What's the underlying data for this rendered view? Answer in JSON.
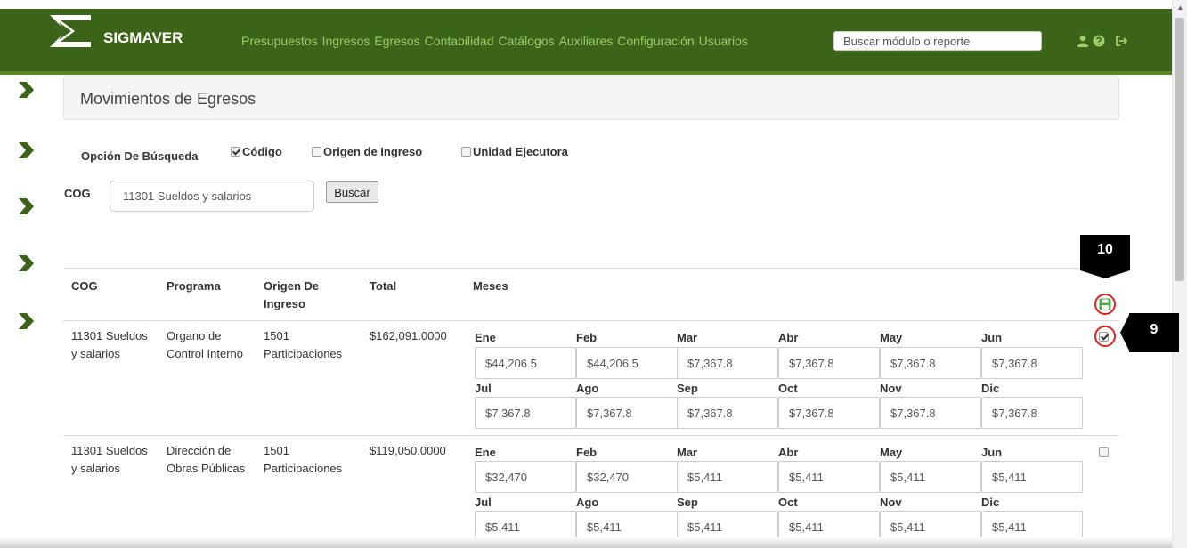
{
  "navbar": {
    "brand": "SIGMAVER",
    "links": [
      "Presupuestos",
      "Ingresos",
      "Egresos",
      "Contabilidad",
      "Catálogos",
      "Auxiliares",
      "Configuración",
      "Usuarios"
    ],
    "search_placeholder": "Buscar módulo o reporte",
    "icons": [
      "user-icon",
      "help-icon",
      "logout-icon"
    ],
    "bg_color": "#3c6419",
    "link_color": "#9ecd6a"
  },
  "sidebar": {
    "chevron_count": 5,
    "color": "#3c6419"
  },
  "page": {
    "title": "Movimientos de Egresos"
  },
  "search_options": {
    "label": "Opción De Búsqueda",
    "options": [
      {
        "label": "Código",
        "checked": true
      },
      {
        "label": "Origen de Ingreso",
        "checked": false
      },
      {
        "label": "Unidad Ejecutora",
        "checked": false
      }
    ],
    "cog_label": "COG",
    "cog_value": "11301 Sueldos y salarios",
    "search_button": "Buscar"
  },
  "table": {
    "headers": {
      "cog": "COG",
      "programa": "Programa",
      "origen": "Origen De Ingreso",
      "total": "Total",
      "meses": "Meses"
    },
    "month_labels": [
      "Ene",
      "Feb",
      "Mar",
      "Abr",
      "May",
      "Jun",
      "Jul",
      "Ago",
      "Sep",
      "Oct",
      "Nov",
      "Dic"
    ],
    "rows": [
      {
        "cog": "11301 Sueldos y salarios",
        "programa": "Organo de Control Interno",
        "origen": "1501 Participaciones",
        "total": "$162,091.0000",
        "months": [
          "$44,206.5",
          "$44,206.5",
          "$7,367.8",
          "$7,367.8",
          "$7,367.8",
          "$7,367.8",
          "$7,367.8",
          "$7,367.8",
          "$7,367.8",
          "$7,367.8",
          "$7,367.8",
          "$7,367.8"
        ],
        "checked": true
      },
      {
        "cog": "11301 Sueldos y salarios",
        "programa": "Dirección de Obras Públicas",
        "origen": "1501 Participaciones",
        "total": "$119,050.0000",
        "months": [
          "$32,470",
          "$32,470",
          "$5,411",
          "$5,411",
          "$5,411",
          "$5,411",
          "$5,411",
          "$5,411",
          "$5,411",
          "$5,411",
          "$5,411",
          "$5,411"
        ],
        "checked": false
      }
    ]
  },
  "annotations": {
    "callout_save": "10",
    "callout_check": "9"
  }
}
